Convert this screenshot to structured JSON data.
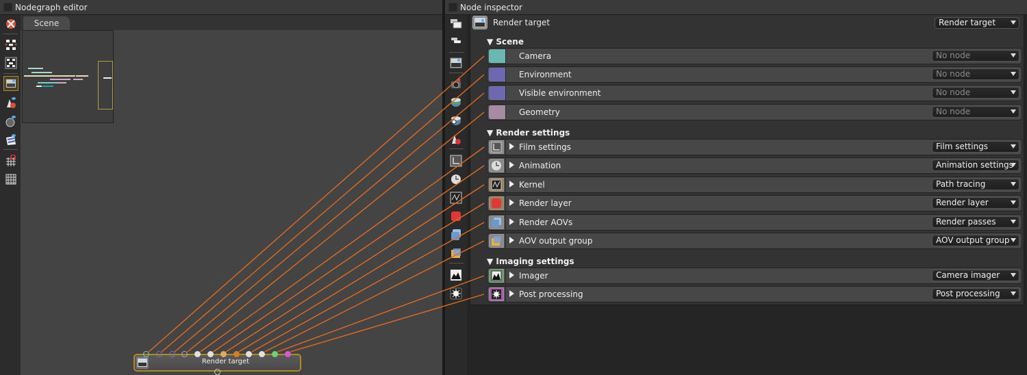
{
  "nodegraph": {
    "title": "Nodegraph editor",
    "tab": "Scene",
    "toolbar_icons": [
      "recenter-icon",
      "arrange-nodes-icon",
      "arrange-selection-icon",
      "render-target-filter-icon",
      "material-filter-icon",
      "geometry-filter-icon",
      "texture-filter-icon",
      "snap-grid-magnet-icon",
      "grid-icon"
    ],
    "node": {
      "label": "Render target",
      "pin_colors": [
        "#6fd0c8",
        "#7b70cc",
        "#7b70cc",
        "#c6a0c0",
        "#e0e0e0",
        "#e0e0e0",
        "#e0a860",
        "#e07a1a",
        "#e0e0e0",
        "#e0e0e0",
        "#6ed26e",
        "#d858d8"
      ]
    },
    "wire_color": "#e46a1e"
  },
  "inspector": {
    "title": "Node inspector",
    "toolbar_icons": [
      "expand-all-icon",
      "collapse-all-icon",
      "render-target-icon",
      "camera-icon",
      "environment-icon",
      "visible-environment-icon",
      "geometry-icon",
      "film-settings-icon",
      "animation-icon",
      "kernel-icon",
      "render-layer-icon",
      "render-aovs-icon",
      "aov-output-group-icon",
      "imager-icon",
      "post-processing-icon"
    ],
    "header": {
      "label": "Render target",
      "combo": "Render target"
    },
    "sections": [
      {
        "title": "Scene",
        "rows": [
          {
            "label": "Camera",
            "value": "No node",
            "color": "#6ab8b2",
            "empty": true
          },
          {
            "label": "Environment",
            "value": "No node",
            "color": "#6d68b0",
            "empty": true
          },
          {
            "label": "Visible environment",
            "value": "No node",
            "color": "#6d68b0",
            "empty": true
          },
          {
            "label": "Geometry",
            "value": "No node",
            "color": "#a88aa4",
            "empty": true
          }
        ]
      },
      {
        "title": "Render settings",
        "rows": [
          {
            "label": "Film settings",
            "value": "Film settings",
            "color": "#8a8a8a",
            "icon": "film-settings-icon"
          },
          {
            "label": "Animation",
            "value": "Animation settings",
            "color": "#8a8a8a",
            "icon": "clock-icon"
          },
          {
            "label": "Kernel",
            "value": "Path tracing",
            "color": "#a08050",
            "icon": "kernel-icon"
          },
          {
            "label": "Render layer",
            "value": "Render layer",
            "color": "#a08050",
            "icon": "render-layer-icon"
          },
          {
            "label": "Render AOVs",
            "value": "Render passes",
            "color": "#8a8a8a",
            "icon": "aov-icon"
          },
          {
            "label": "AOV output group",
            "value": "AOV output group",
            "color": "#8a8a8a",
            "icon": "aov-output-icon"
          }
        ]
      },
      {
        "title": "Imaging settings",
        "rows": [
          {
            "label": "Imager",
            "value": "Camera imager",
            "color": "#5aa068",
            "icon": "imager-icon"
          },
          {
            "label": "Post processing",
            "value": "Post processing",
            "color": "#b058b8",
            "icon": "post-processing-icon"
          }
        ]
      }
    ]
  }
}
